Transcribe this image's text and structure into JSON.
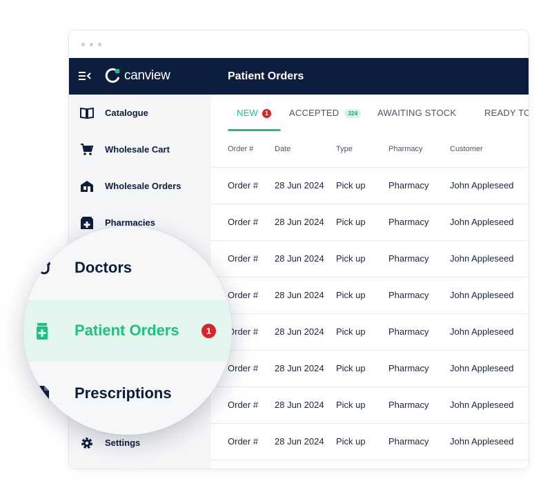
{
  "app": {
    "logo_text": "canview",
    "page_title": "Patient Orders"
  },
  "colors": {
    "navy": "#0d1d3e",
    "accent": "#1fbf86",
    "badge": "#d8232a"
  },
  "sidebar": {
    "items": [
      {
        "label": "Catalogue",
        "icon": "book-icon"
      },
      {
        "label": "Wholesale Cart",
        "icon": "cart-icon"
      },
      {
        "label": "Wholesale Orders",
        "icon": "warehouse-icon"
      },
      {
        "label": "Pharmacies",
        "icon": "pharmacy-icon"
      },
      {
        "label": "Settings",
        "icon": "gear-icon"
      }
    ]
  },
  "magnifier": {
    "items": [
      {
        "label": "Doctors",
        "icon": "stethoscope-icon"
      },
      {
        "label": "Patient Orders",
        "icon": "medicine-jar-icon",
        "badge": "1"
      },
      {
        "label": "Prescriptions",
        "icon": "prescription-icon"
      }
    ]
  },
  "tabs": [
    {
      "label": "NEW",
      "badge": "1"
    },
    {
      "label": "ACCEPTED",
      "badge": "324"
    },
    {
      "label": "AWAITING STOCK"
    },
    {
      "label": "READY TO"
    }
  ],
  "table": {
    "columns": [
      "Order #",
      "Date",
      "Type",
      "Pharmacy",
      "Customer"
    ],
    "rows": [
      [
        "Order #",
        "28 Jun 2024",
        "Pick up",
        "Pharmacy",
        "John Appleseed"
      ],
      [
        "Order #",
        "28 Jun 2024",
        "Pick up",
        "Pharmacy",
        "John Appleseed"
      ],
      [
        "Order #",
        "28 Jun 2024",
        "Pick up",
        "Pharmacy",
        "John Appleseed"
      ],
      [
        "Order #",
        "28 Jun 2024",
        "Pick up",
        "Pharmacy",
        "John Appleseed"
      ],
      [
        "Order #",
        "28 Jun 2024",
        "Pick up",
        "Pharmacy",
        "John Appleseed"
      ],
      [
        "Order #",
        "28 Jun 2024",
        "Pick up",
        "Pharmacy",
        "John Appleseed"
      ],
      [
        "Order #",
        "28 Jun 2024",
        "Pick up",
        "Pharmacy",
        "John Appleseed"
      ],
      [
        "Order #",
        "28 Jun 2024",
        "Pick up",
        "Pharmacy",
        "John Appleseed"
      ]
    ]
  }
}
